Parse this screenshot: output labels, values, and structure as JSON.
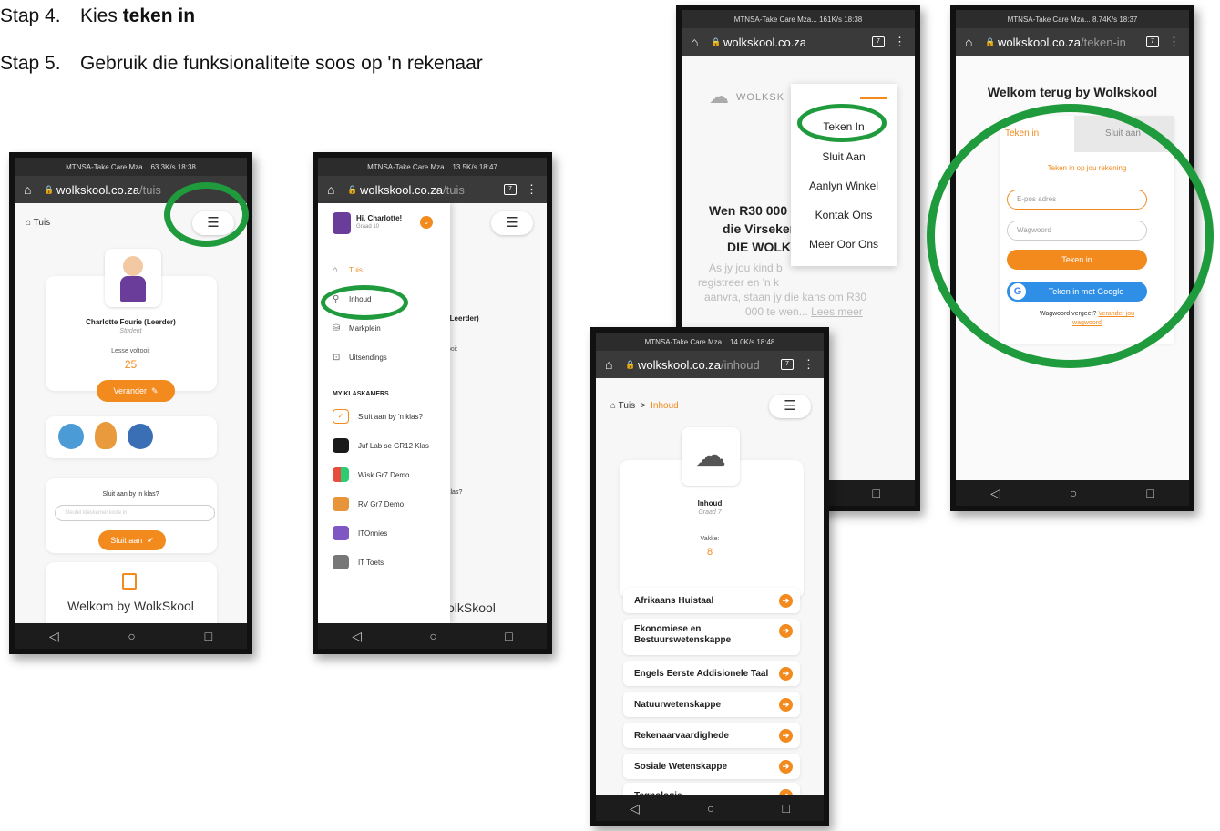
{
  "instructions": [
    {
      "number": "Stap 4.",
      "prefix": "Kies ",
      "bold": "teken in"
    },
    {
      "number": "Stap 5.",
      "text": "Gebruik die funksionaliteite soos op 'n rekenaar"
    }
  ],
  "phone1": {
    "status": "MTNSA-Take Care Mza... 63.3K/s  18:38",
    "url_host": "wolkskool.co.za",
    "url_path": "/tuis",
    "breadcrumb": "Tuis",
    "profile_name": "Charlotte Fourie (Leerder)",
    "profile_role": "Student",
    "lessons_label": "Lesse voltooi:",
    "lessons_count": "25",
    "edit_button": "Verander",
    "join_title": "Sluit aan by 'n klas?",
    "join_placeholder": "Sleutel klaskamer kode in",
    "join_button": "Sluit aan",
    "welcome": "Welkom by WolkSkool"
  },
  "phone2": {
    "status": "MTNSA-Take Care Mza... 13.5K/s  18:47",
    "url_host": "wolkskool.co.za",
    "url_path": "/tuis",
    "greeting": "Hi, Charlotte!",
    "grade": "Graad 10",
    "menu": [
      "Tuis",
      "Inhoud",
      "Markplein",
      "Uitsendings"
    ],
    "section_title": "MY KLASKAMERS",
    "classes": [
      "Sluit aan by 'n klas?",
      "Juf Lab se GR12 Klas",
      "Wisk Gr7 Demo",
      "RV Gr7 Demo",
      "ITOnnies",
      "IT Toets"
    ],
    "behind_profile": "(Leerder)",
    "behind_lessons": "ooi:",
    "behind_join": "klas?",
    "behind_welcome": "olkSkool"
  },
  "phone3": {
    "status": "MTNSA-Take Care Mza... 161K/s  18:38",
    "url_host": "wolkskool.co.za",
    "logo": "WOLKSK",
    "dropdown": [
      "Teken In",
      "Sluit Aan",
      "Aanlyn Winkel",
      "Kontak Ons",
      "Meer Oor Ons"
    ],
    "headline_1": "Wen R30 000",
    "headline_2": "die Virseker",
    "headline_3": "DIE WOLKI",
    "body_1": "As jy jou kind b",
    "body_2": "registreer en 'n k",
    "body_3": "aanvra, staan jy die kans om R30",
    "body_4": "000 te wen...",
    "body_link": "Lees meer"
  },
  "phone4": {
    "status": "MTNSA-Take Care Mza... 14.0K/s  18:48",
    "url_host": "wolkskool.co.za",
    "url_path": "/inhoud",
    "breadcrumb_home": "Tuis",
    "breadcrumb_sep": ">",
    "breadcrumb_current": "Inhoud",
    "title": "Inhoud",
    "grade": "Graad 7",
    "subjects_label": "Vakke:",
    "subjects_count": "8",
    "subjects": [
      "Afrikaans Huistaal",
      "Ekonomiese en Bestuurswetenskappe",
      "Engels Eerste Addisionele Taal",
      "Natuurwetenskappe",
      "Rekenaarvaardighede",
      "Sosiale Wetenskappe",
      "Tegnologie"
    ]
  },
  "phone5": {
    "status": "MTNSA-Take Care Mza... 8.74K/s  18:37",
    "url_host": "wolkskool.co.za",
    "url_path": "/teken-in",
    "welcome": "Welkom terug by Wolkskool",
    "tab_login": "Teken in",
    "tab_register": "Sluit aan",
    "subtitle": "Teken in op jou rekening",
    "email_placeholder": "E-pos adres",
    "password_placeholder": "Wagwoord",
    "login_button": "Teken in",
    "google_button": "Teken in met Google",
    "forgot_text": "Wagwoord vergeet?",
    "forgot_link_1": "Verander jou",
    "forgot_link_2": "wagwoord"
  },
  "colors": {
    "accent": "#f28a1e",
    "highlight_ring": "#1f9a3c",
    "google_blue": "#2f8fe6"
  },
  "icons": [
    "home-icon",
    "lock-icon",
    "tabs-icon",
    "more-icon",
    "hamburger-icon",
    "pencil-icon",
    "check-icon",
    "book-icon",
    "search-icon",
    "basket-icon",
    "broadcast-icon",
    "arrow-right-icon",
    "back-icon",
    "circle-home-icon",
    "square-recent-icon",
    "cloud-icon",
    "google-icon"
  ]
}
